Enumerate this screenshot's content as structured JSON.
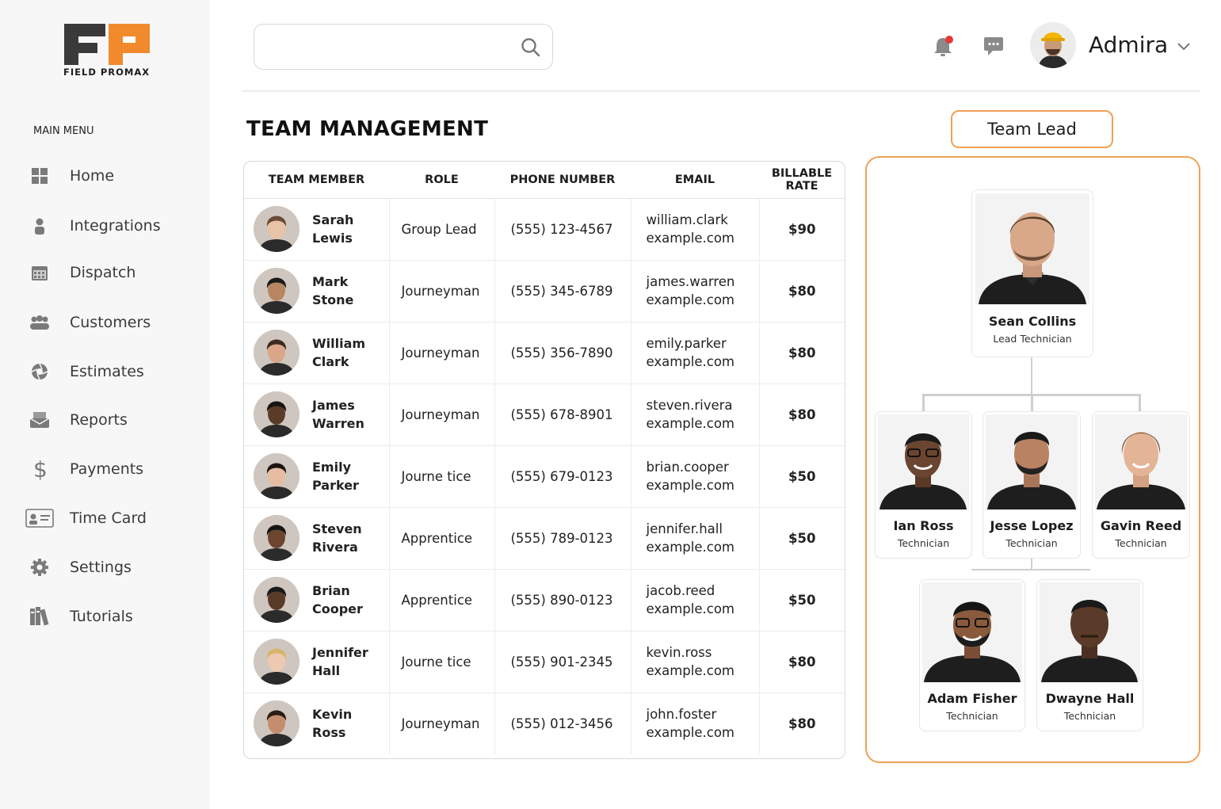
{
  "brand": {
    "name": "FIELD PROMAX",
    "logo_letters": "FP",
    "primary_color": "#3a3a3a",
    "accent_color": "#f08a2c"
  },
  "sidebar": {
    "menu_title": "MAIN MENU",
    "items": [
      {
        "label": "Home",
        "icon": "grid-icon"
      },
      {
        "label": "Integrations",
        "icon": "person-icon"
      },
      {
        "label": "Dispatch",
        "icon": "calendar-icon"
      },
      {
        "label": "Customers",
        "icon": "group-icon"
      },
      {
        "label": "Estimates",
        "icon": "aperture-icon"
      },
      {
        "label": "Reports",
        "icon": "inbox-icon"
      },
      {
        "label": "Payments",
        "icon": "dollar-icon"
      },
      {
        "label": "Time Card",
        "icon": "id-card-icon"
      },
      {
        "label": "Settings",
        "icon": "gear-icon"
      },
      {
        "label": "Tutorials",
        "icon": "books-icon"
      }
    ]
  },
  "header": {
    "search_placeholder": "",
    "user_name": "Admira",
    "notification_dot_color": "#e53935"
  },
  "page": {
    "title": "TEAM MANAGEMENT"
  },
  "table": {
    "columns": [
      "TEAM MEMBER",
      "ROLE",
      "PHONE NUMBER",
      "EMAIL",
      "BILLABLE RATE"
    ],
    "rows": [
      {
        "first": "Sarah",
        "last": "Lewis",
        "role": "Group Lead",
        "phone": "(555) 123-4567",
        "email_user": "william.clark",
        "email_domain": "example.com",
        "rate": "$90"
      },
      {
        "first": "Mark",
        "last": "Stone",
        "role": "Journeyman",
        "phone": "(555) 345-6789",
        "email_user": "james.warren",
        "email_domain": "example.com",
        "rate": "$80"
      },
      {
        "first": "William",
        "last": "Clark",
        "role": "Journeyman",
        "phone": "(555) 356-7890",
        "email_user": "emily.parker",
        "email_domain": "example.com",
        "rate": "$80"
      },
      {
        "first": "James",
        "last": "Warren",
        "role": "Journeyman",
        "phone": "(555) 678-8901",
        "email_user": "steven.rivera",
        "email_domain": "example.com",
        "rate": "$80"
      },
      {
        "first": "Emily",
        "last": "Parker",
        "role": "Journe tice",
        "phone": "(555) 679-0123",
        "email_user": "brian.cooper",
        "email_domain": "example.com",
        "rate": "$50"
      },
      {
        "first": "Steven",
        "last": "Rivera",
        "role": "Apprentice",
        "phone": "(555) 789-0123",
        "email_user": "jennifer.hall",
        "email_domain": "example.com",
        "rate": "$50"
      },
      {
        "first": "Brian",
        "last": "Cooper",
        "role": "Apprentice",
        "phone": "(555) 890-0123",
        "email_user": "jacob.reed",
        "email_domain": "example.com",
        "rate": "$50"
      },
      {
        "first": "Jennifer",
        "last": "Hall",
        "role": "Journe tice",
        "phone": "(555) 901-2345",
        "email_user": "kevin.ross",
        "email_domain": "example.com",
        "rate": "$80"
      },
      {
        "first": "Kevin",
        "last": "Ross",
        "role": "Journeyman",
        "phone": "(555) 012-3456",
        "email_user": "john.foster",
        "email_domain": "example.com",
        "rate": "$80"
      }
    ]
  },
  "org_chart": {
    "button_label": "Team Lead",
    "lead": {
      "name": "Sean Collins",
      "role": "Lead Technician"
    },
    "level2": [
      {
        "name": "Ian Ross",
        "role": "Technician"
      },
      {
        "name": "Jesse Lopez",
        "role": "Technician"
      },
      {
        "name": "Gavin Reed",
        "role": "Technician"
      }
    ],
    "level3": [
      {
        "name": "Adam Fisher",
        "role": "Technician"
      },
      {
        "name": "Dwayne Hall",
        "role": "Technician"
      }
    ]
  }
}
